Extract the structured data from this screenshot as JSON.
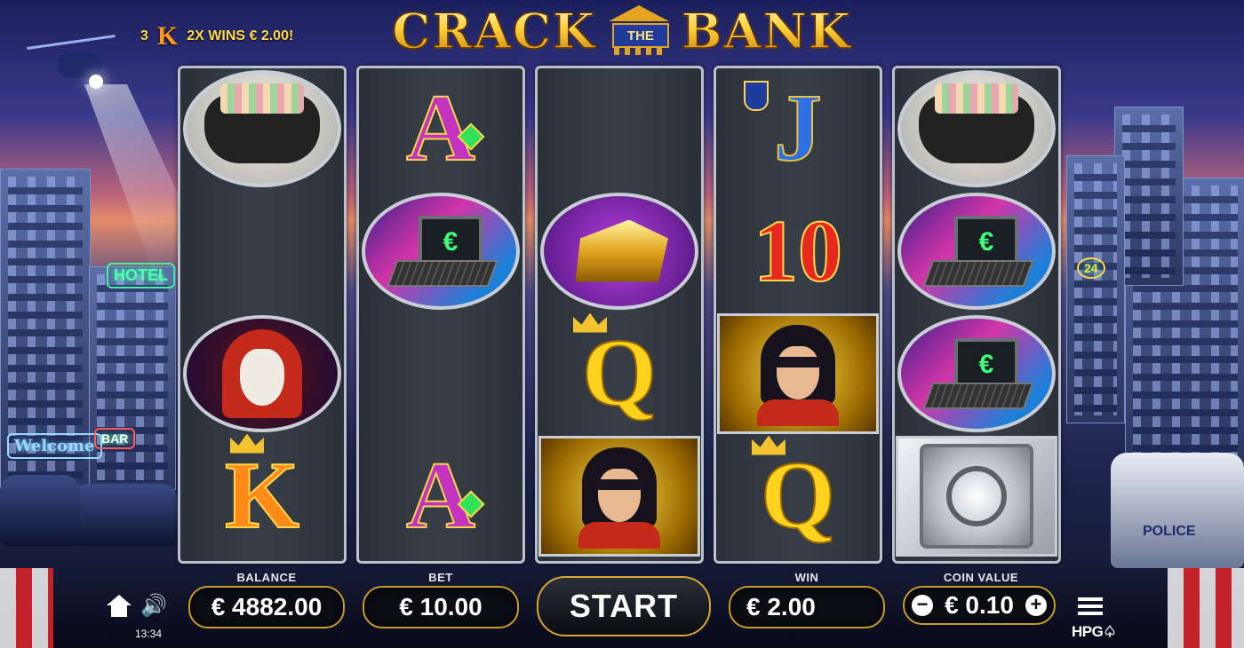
{
  "header": {
    "win_count": "3",
    "win_symbol": "K",
    "win_text": "2X WINS € 2.00!",
    "logo_left": "CRACK",
    "logo_mid": "THE",
    "logo_right": "BANK"
  },
  "scenery": {
    "hotel_sign": "HOTEL",
    "welcome_sign": "Welcome",
    "bar_sign": "BAR",
    "police_text": "POLICE",
    "hours_sign": "24"
  },
  "reels": [
    [
      "money-bag",
      "",
      "hacker",
      "K"
    ],
    [
      "A",
      "laptop",
      "",
      "A"
    ],
    [
      "",
      "gold-bars",
      "Q",
      "thief"
    ],
    [
      "J",
      "10",
      "thief",
      "Q"
    ],
    [
      "money-bag",
      "laptop",
      "laptop",
      "vault"
    ]
  ],
  "symbol_text": {
    "laptop_screen": "€"
  },
  "controls": {
    "balance_label": "BALANCE",
    "balance_value": "€ 4882.00",
    "bet_label": "BET",
    "bet_value": "€ 10.00",
    "start_label": "START",
    "win_label": "WIN",
    "win_value": "€ 2.00",
    "coin_label": "COIN VALUE",
    "coin_value": "€ 0.10",
    "minus": "−",
    "plus": "+",
    "time": "13:34",
    "brand": "HPG"
  },
  "colors": {
    "accent_gold": "#d6a832",
    "panel": "#0a0c12"
  }
}
